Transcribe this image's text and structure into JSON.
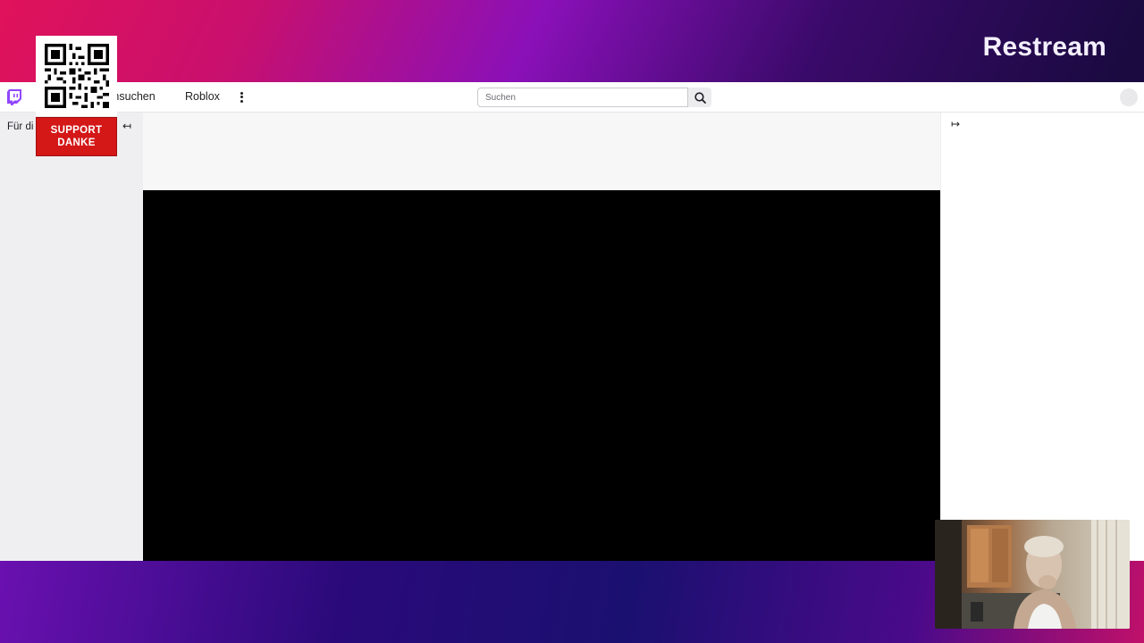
{
  "overlay": {
    "brand": "Restream",
    "support_line1": "SUPPORT",
    "support_line2": "DANKE"
  },
  "topbar": {
    "nav": [
      {
        "label": "rchsuchen"
      },
      {
        "label": "Roblox"
      }
    ],
    "search_placeholder": "Suchen"
  },
  "sidebar": {
    "title": "Für di"
  },
  "icons": {
    "logo": "twitch-logo-icon",
    "more": "more-vertical-icon",
    "search": "search-icon",
    "collapse": "arrow-left-collapse-icon",
    "expand": "arrow-right-expand-icon"
  },
  "colors": {
    "accent": "#9146ff",
    "support_red": "#d41717",
    "video_bg": "#000000",
    "sidebar_bg": "#efeff1"
  }
}
